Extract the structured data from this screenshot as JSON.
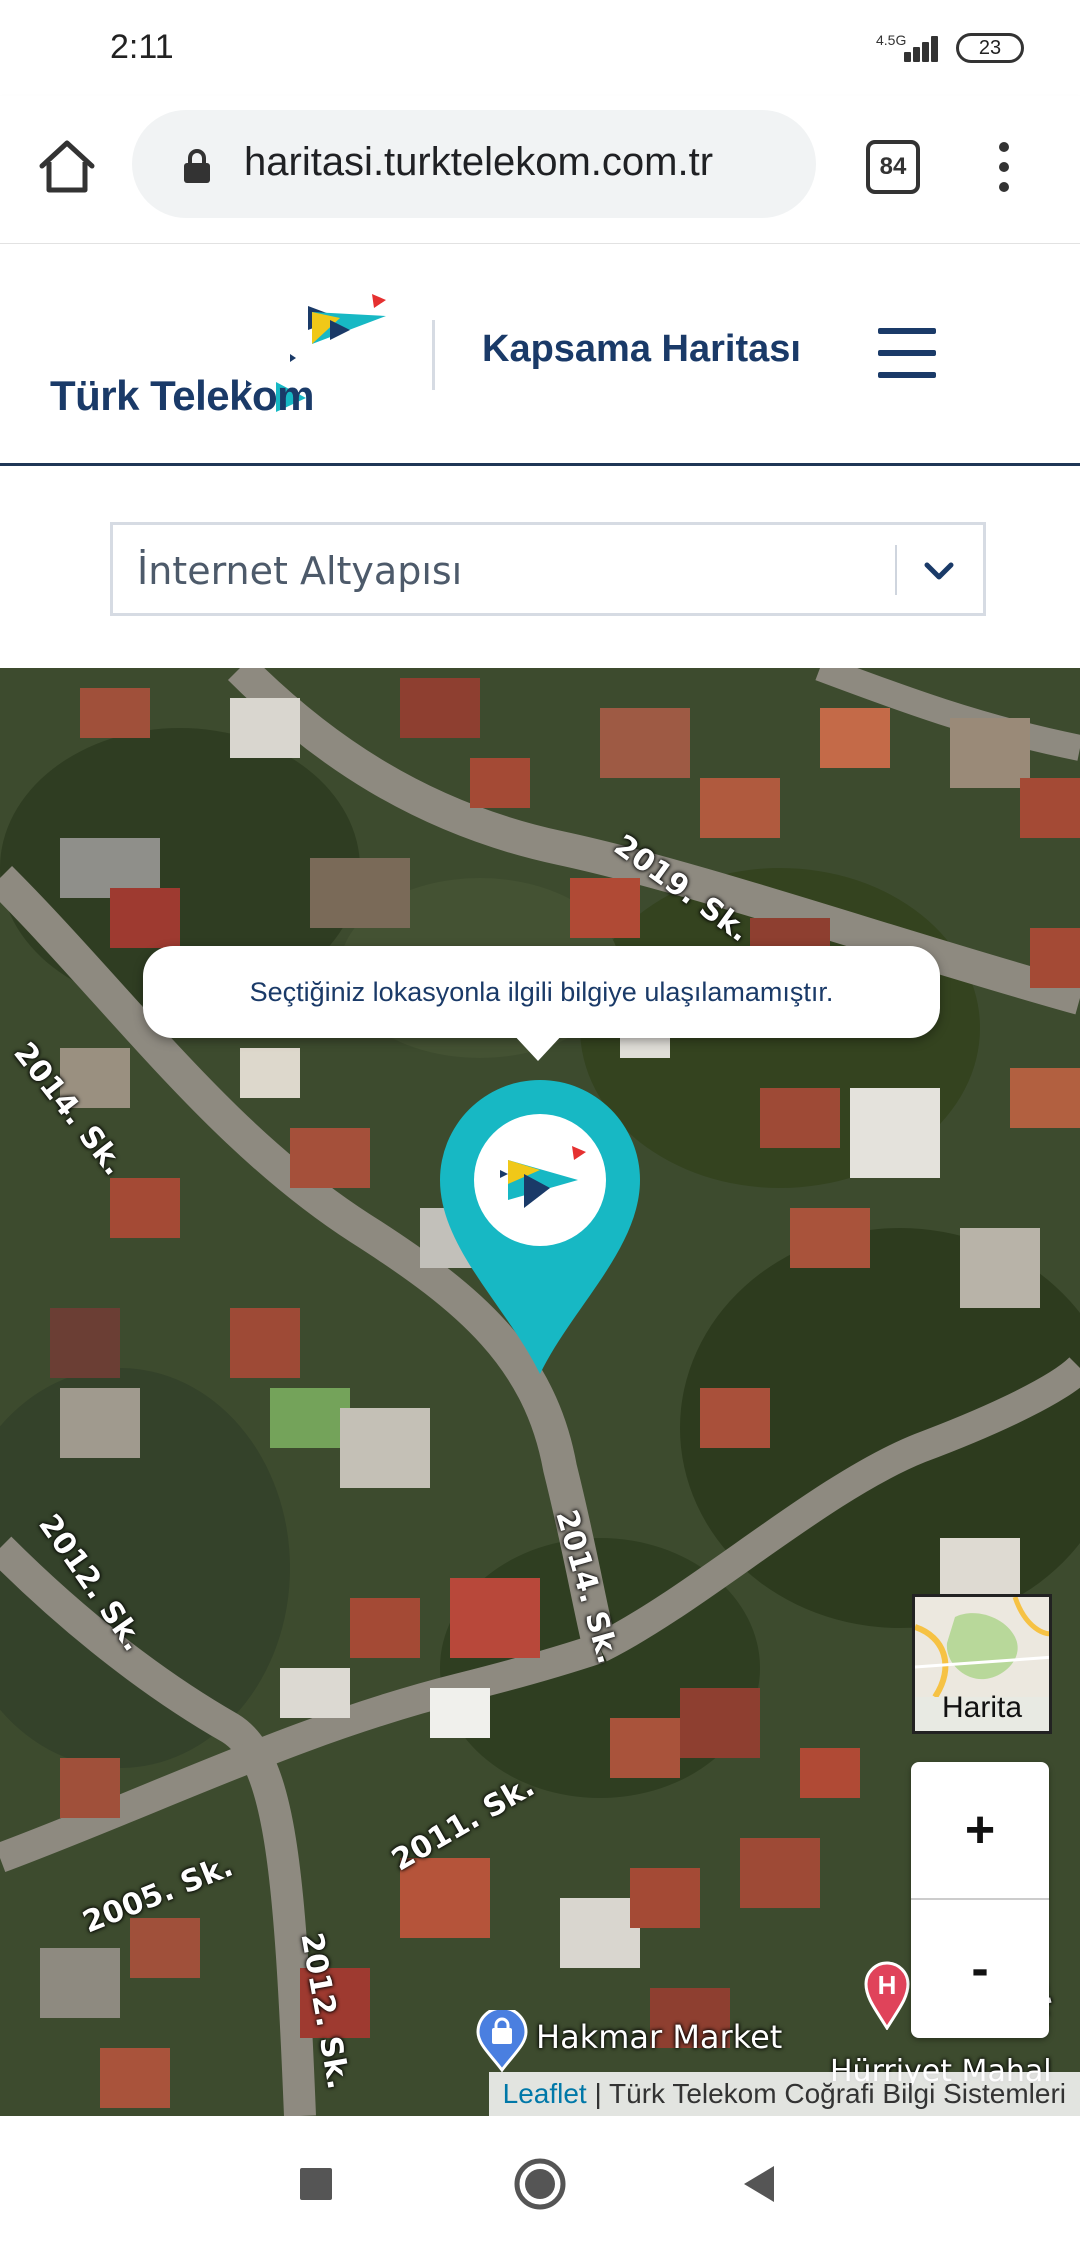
{
  "status_bar": {
    "time": "2:11",
    "network": "4.5G",
    "battery": "23"
  },
  "browser": {
    "url": "haritasi.turktelekom.com.tr",
    "tab_count": "84",
    "icons": [
      "home-icon",
      "lock-icon",
      "tabs-icon",
      "overflow-menu-icon"
    ]
  },
  "header": {
    "brand": "Türk Telekom",
    "title": "Kapsama Haritası",
    "menu_icon": "hamburger-icon"
  },
  "filter": {
    "selected": "İnternet Altyapısı",
    "icon": "chevron-down-icon"
  },
  "map": {
    "popup_message": "Seçtiğiniz lokasyonla ilgili bilgiye ulaşılamamıştır.",
    "layer_toggle_label": "Harita",
    "zoom_in": "+",
    "zoom_out": "-",
    "attribution_link": "Leaflet",
    "attribution_text": " | Türk Telekom Coğrafi Bilgi Sistemleri",
    "streets": [
      "2019. Sk.",
      "2014. Sk.",
      "2014. Sk.",
      "2012. Sk.",
      "2011. Sk.",
      "2005. Sk.",
      "2012. Sk.",
      "Sk."
    ],
    "poi": [
      "Hakmar Market",
      "Hürriyet Mahal"
    ],
    "colors": {
      "pin": "#17b8c4",
      "brand_navy": "#1a3a68"
    }
  },
  "nav_bar": {
    "icons": [
      "recents-icon",
      "home-circle-icon",
      "back-icon"
    ]
  }
}
